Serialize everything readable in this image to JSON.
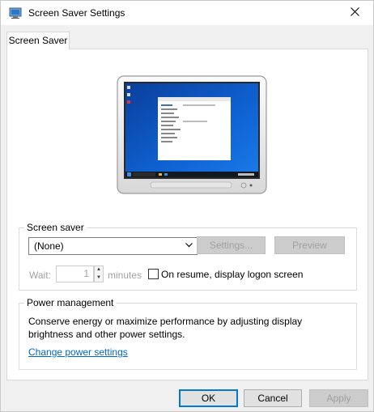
{
  "window": {
    "title": "Screen Saver Settings"
  },
  "tabs": [
    {
      "label": "Screen Saver"
    }
  ],
  "screen_saver": {
    "group_label": "Screen saver",
    "selected": "(None)",
    "settings_label": "Settings...",
    "preview_label": "Preview",
    "wait_label": "Wait:",
    "wait_value": "1",
    "minutes_label": "minutes",
    "resume_label": "On resume, display logon screen",
    "resume_checked": false
  },
  "power": {
    "group_label": "Power management",
    "description": "Conserve energy or maximize performance by adjusting display brightness and other power settings.",
    "link_label": "Change power settings"
  },
  "footer": {
    "ok_label": "OK",
    "cancel_label": "Cancel",
    "apply_label": "Apply"
  },
  "icons": {
    "title": "screen-saver-settings-icon",
    "close": "close-icon",
    "dropdown": "chevron-down-icon",
    "spin_up": "spin-up-icon",
    "spin_down": "spin-down-icon"
  },
  "colors": {
    "accent": "#0078d7",
    "link": "#0066cc",
    "desktop": "#0a4fb7"
  }
}
